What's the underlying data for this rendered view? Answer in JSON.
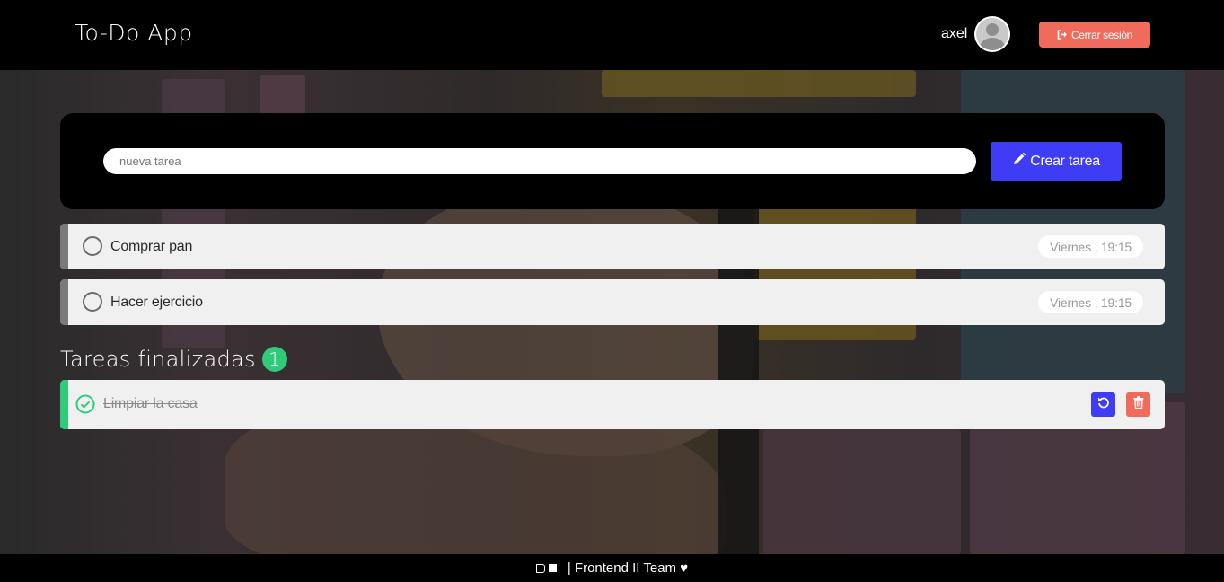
{
  "header": {
    "title": "To-Do App",
    "user_name": "axel",
    "logout_label": "Cerrar sesión"
  },
  "form": {
    "placeholder": "nueva tarea",
    "create_label": "Crear tarea"
  },
  "pending_tasks": [
    {
      "label": "Comprar pan",
      "date": "Viernes , 19:15"
    },
    {
      "label": "Hacer ejercicio",
      "date": "Viernes , 19:15"
    }
  ],
  "completed": {
    "title": "Tareas finalizadas",
    "count": "1",
    "tasks": [
      {
        "label": "Limpiar la casa"
      }
    ]
  },
  "footer": {
    "text": "| Frontend II Team ♥"
  },
  "colors": {
    "accent_blue": "#3f3cf5",
    "accent_red": "#f06b5b",
    "accent_green": "#2ecc7a",
    "header_bg": "#000000"
  },
  "icons": {
    "logout": "sign-out-icon",
    "create": "pencil-icon",
    "restore": "undo-icon",
    "delete": "trash-icon",
    "done": "check-circle-icon"
  }
}
